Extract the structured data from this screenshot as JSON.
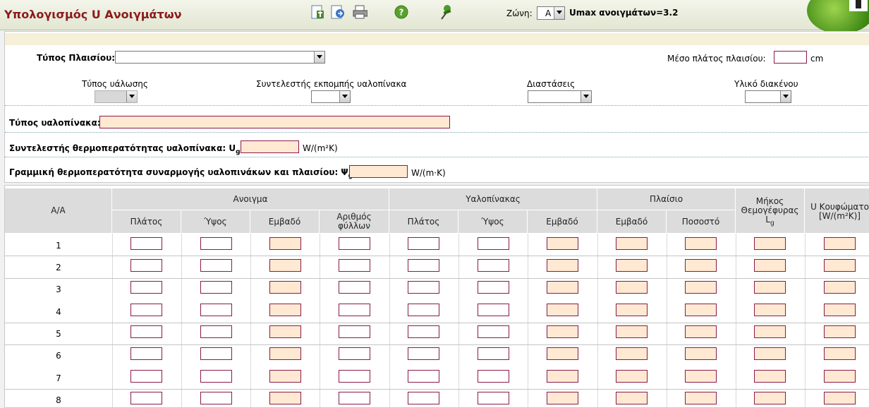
{
  "app": {
    "title": "Υπολογισμός U Ανοιγμάτων"
  },
  "toolbar": {
    "icons": [
      "save-icon",
      "export-icon",
      "print-icon",
      "help-icon",
      "pin-icon"
    ],
    "zone_label": "Ζώνη:",
    "zone_value": "A",
    "umax_text": "Umax ανοιγμάτων=3.2"
  },
  "form": {
    "frame_type_label": "Τύπος Πλαισίου:",
    "frame_type_value": "",
    "frame_width_label": "Μέσο πλάτος πλαισίου:",
    "frame_width_value": "",
    "frame_width_unit": "cm",
    "glazing_type_label": "Τύπος υάλωσης",
    "emission_label": "Συντελεστής εκπομπής υαλοπίνακα",
    "dimensions_label": "Διαστάσεις",
    "spacer_label": "Υλικό διακένου",
    "glass_type_label": "Τύπος υαλοπίνακα:",
    "glass_type_value": "",
    "ug_label_pre": "Συντελεστής θερμοπερατότητας υαλοπίνακα: U",
    "ug_sub": "g",
    "ug_eq": "=",
    "ug_unit": "W/(m²K)",
    "psi_label_pre": "Γραμμική θερμοπερατότητα συναρμογής υαλοπινάκων και πλαισίου: Ψ",
    "psi_sub": "g",
    "psi_eq": "=",
    "psi_unit": "W/(m·K)"
  },
  "table": {
    "aa_header": "Α/Α",
    "group_opening": "Ανοιγμα",
    "group_glass": "Υαλοπίνακας",
    "group_frame": "Πλαίσιο",
    "length_header_pre": "Μήκος Θεμογέφυρας L",
    "length_header_sub": "g",
    "u_header": "U Κουφώματο [W/(m²K)]",
    "subheaders": [
      "Πλάτος",
      "Ύψος",
      "Εμβαδό",
      "Αριθμός φύλλων",
      "Πλάτος",
      "Ύψος",
      "Εμβαδό",
      "Εμβαδό",
      "Ποσοστό"
    ],
    "rows": [
      "1",
      "2",
      "3",
      "4",
      "5",
      "6",
      "7",
      "8"
    ]
  }
}
